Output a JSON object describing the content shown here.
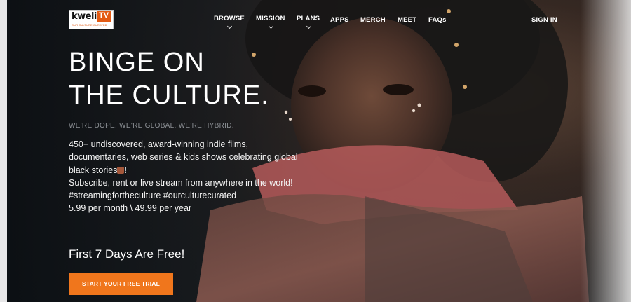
{
  "logo": {
    "brand": "kweli",
    "tv": "TV",
    "tagline": "OUR CULTURE CURATED"
  },
  "nav": {
    "items": [
      {
        "label": "BROWSE",
        "has_menu": true
      },
      {
        "label": "MISSION",
        "has_menu": true
      },
      {
        "label": "PLANS",
        "has_menu": true
      },
      {
        "label": "APPS",
        "has_menu": false
      },
      {
        "label": "MERCH",
        "has_menu": false
      },
      {
        "label": "MEET",
        "has_menu": false
      },
      {
        "label": "FAQs",
        "has_menu": false
      }
    ],
    "sign_in": "SIGN IN"
  },
  "hero": {
    "headline_line1": "BINGE ON",
    "headline_line2": "THE CULTURE.",
    "tagline": "WE'RE DOPE. WE'RE GLOBAL. WE'RE HYBRID.",
    "desc_line1": "450+ undiscovered, award-winning indie films, documentaries, web series & kids shows celebrating global black stories",
    "desc_line1_end": "!",
    "desc_line2": "Subscribe, rent or live stream from anywhere in the world!",
    "desc_line3": "#streamingfortheculture #ourculturecurated",
    "desc_line4": "5.99 per month \\ 49.99 per year",
    "free_trial_heading": "First 7 Days Are Free!",
    "cta_label": "START YOUR FREE TRIAL"
  },
  "colors": {
    "accent": "#f0761c",
    "tagline": "#8b8f94"
  }
}
